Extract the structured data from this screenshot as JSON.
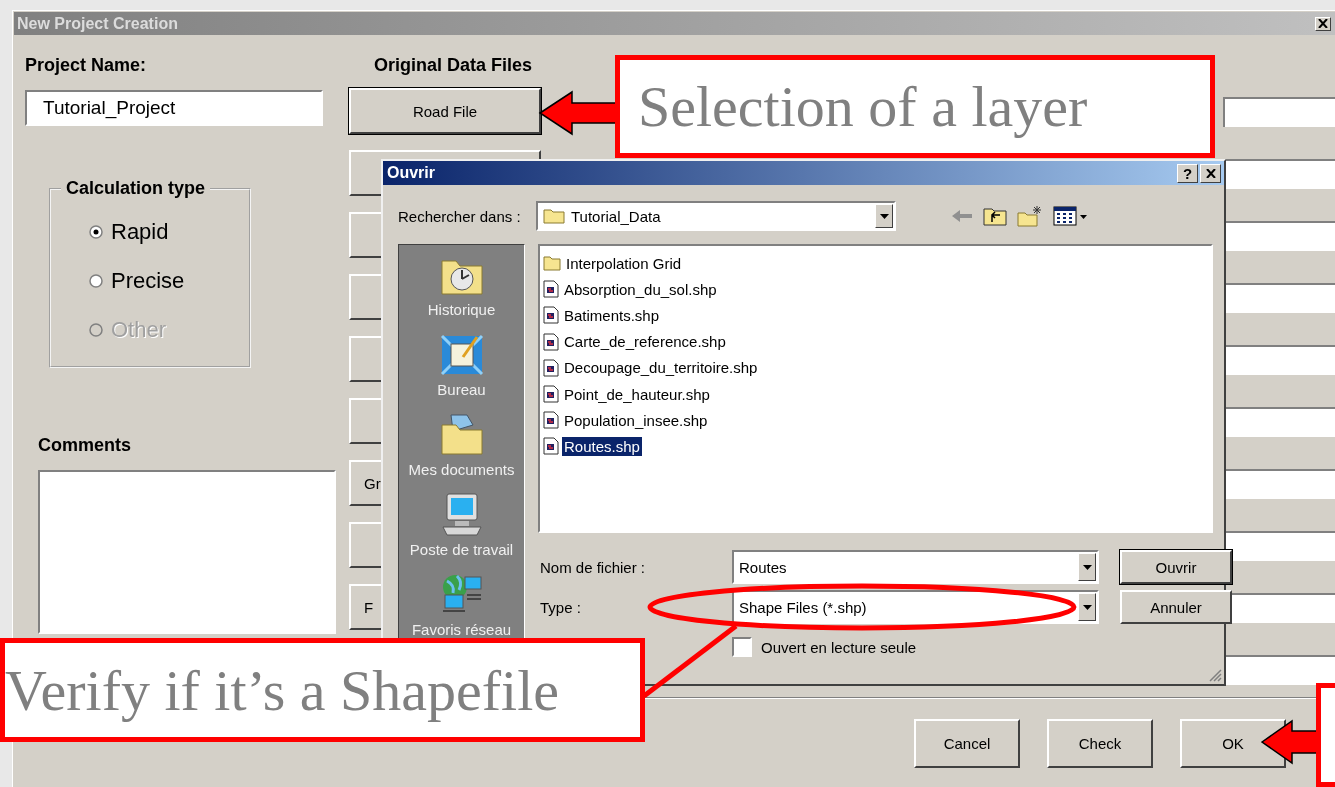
{
  "window": {
    "title": "New Project Creation"
  },
  "project": {
    "label": "Project Name:",
    "value": "Tutorial_Project"
  },
  "calculation_type": {
    "title": "Calculation type",
    "options": [
      {
        "label": "Rapid",
        "selected": true,
        "disabled": false
      },
      {
        "label": "Precise",
        "selected": false,
        "disabled": false
      },
      {
        "label": "Other",
        "selected": false,
        "disabled": true
      }
    ]
  },
  "comments": {
    "label": "Comments"
  },
  "data_files": {
    "title": "Original Data Files",
    "rows": [
      {
        "kind": "labeled",
        "label": "Road File"
      },
      {
        "kind": "blank"
      },
      {
        "kind": "blank"
      },
      {
        "kind": "blank"
      },
      {
        "kind": "blank"
      },
      {
        "kind": "blank"
      },
      {
        "kind": "partial",
        "label": "Gr"
      },
      {
        "kind": "blank"
      },
      {
        "kind": "partial",
        "label": "F"
      },
      {
        "kind": "field_only"
      }
    ]
  },
  "footer_buttons": [
    "Cancel",
    "Check",
    "OK"
  ],
  "open_dialog": {
    "title": "Ouvrir",
    "help_label": "?",
    "look_in_label": "Rechercher dans :",
    "look_in": "Tutorial_Data",
    "places": [
      "Historique",
      "Bureau",
      "Mes documents",
      "Poste de travail",
      "Favoris réseau"
    ],
    "files": [
      {
        "name": "Interpolation Grid",
        "kind": "folder",
        "selected": false
      },
      {
        "name": "Absorption_du_sol.shp",
        "kind": "file",
        "selected": false
      },
      {
        "name": "Batiments.shp",
        "kind": "file",
        "selected": false
      },
      {
        "name": "Carte_de_reference.shp",
        "kind": "file",
        "selected": false
      },
      {
        "name": "Decoupage_du_territoire.shp",
        "kind": "file",
        "selected": false
      },
      {
        "name": "Point_de_hauteur.shp",
        "kind": "file",
        "selected": false
      },
      {
        "name": "Population_insee.shp",
        "kind": "file",
        "selected": false
      },
      {
        "name": "Routes.shp",
        "kind": "file",
        "selected": true
      }
    ],
    "file_name_label": "Nom de fichier :",
    "file_name": "Routes",
    "type_label": "Type :",
    "type": "Shape Files (*.shp)",
    "read_only": {
      "label": "Ouvert en lecture seule",
      "checked": false
    },
    "buttons": [
      "Ouvrir",
      "Annuler"
    ]
  },
  "annotations": [
    {
      "kind": "callout",
      "text": "Selection of a layer"
    },
    {
      "kind": "callout",
      "text": "Verify if it’s a Shapefile"
    },
    {
      "kind": "empty_callout"
    }
  ]
}
